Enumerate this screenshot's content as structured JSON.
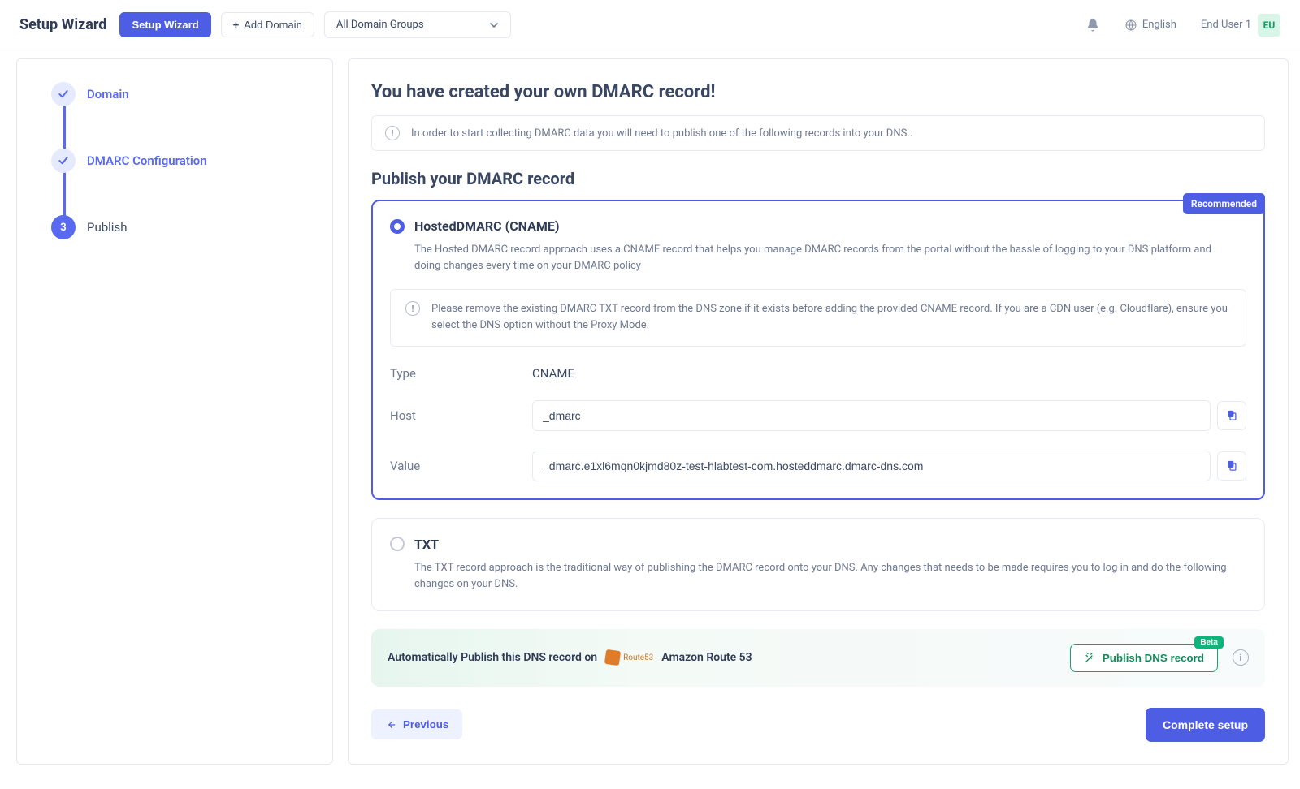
{
  "topbar": {
    "brand": "Setup Wizard",
    "primary_button": "Setup Wizard",
    "add_domain": "Add Domain",
    "domain_group_selected": "All Domain Groups",
    "language": "English",
    "user_name": "End User 1",
    "user_initials": "EU"
  },
  "sidebar": {
    "steps": [
      {
        "label": "Domain",
        "state": "done"
      },
      {
        "label": "DMARC Configuration",
        "state": "done"
      },
      {
        "label": "Publish",
        "state": "current",
        "number": "3"
      }
    ]
  },
  "main": {
    "title": "You have created your own DMARC record!",
    "top_alert": "In order to start collecting DMARC data you will need to publish one of the following records into your DNS..",
    "subtitle": "Publish your DMARC record",
    "options": {
      "hosted": {
        "title": "HostedDMARC (CNAME)",
        "recommended_badge": "Recommended",
        "description": "The Hosted DMARC record approach uses a CNAME record that helps you manage DMARC records from the portal without the hassle of logging to your DNS platform and doing changes every time on your DMARC policy",
        "warning": "Please remove the existing DMARC TXT record from the DNS zone if it exists before adding the provided CNAME record. If you are a CDN user (e.g. Cloudflare), ensure you select the DNS option without the Proxy Mode.",
        "type_label": "Type",
        "type_value": "CNAME",
        "host_label": "Host",
        "host_value": "_dmarc",
        "value_label": "Value",
        "value_value": "_dmarc.e1xl6mqn0kjmd80z-test-hlabtest-com.hosteddmarc.dmarc-dns.com"
      },
      "txt": {
        "title": "TXT",
        "description": "The TXT record approach is the traditional way of publishing the DMARC record onto your DNS. Any changes that needs to be made requires you to log in and do the following changes on your DNS."
      }
    },
    "auto_publish": {
      "prefix": "Automatically Publish this DNS record on",
      "provider": "Amazon Route 53",
      "button": "Publish DNS record",
      "beta": "Beta"
    },
    "footer": {
      "previous": "Previous",
      "complete": "Complete setup"
    }
  }
}
